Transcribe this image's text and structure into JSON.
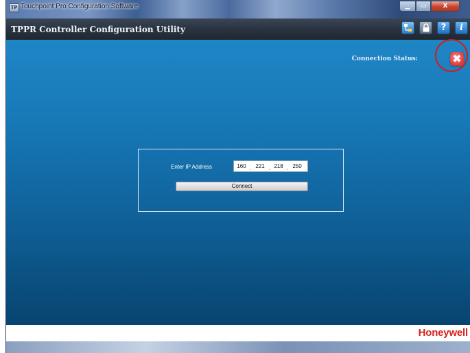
{
  "window": {
    "title": "Touchpoint Pro Configuration Software",
    "app_icon": "TP",
    "controls": {
      "minimize": "▁",
      "maximize": "▭",
      "close": "X"
    }
  },
  "header": {
    "title": "TPPR Controller Configuration Utility",
    "icons": {
      "network": "network-settings-icon",
      "lock": "lock-icon",
      "help": "?",
      "info": "i"
    }
  },
  "main": {
    "connection_status_label": "Connection Status:",
    "connection_status_icon": "✖",
    "connection_state": "disconnected",
    "ip_form": {
      "label": "Enter IP Address",
      "octets": [
        "160",
        "221",
        "218",
        "250"
      ],
      "connect_label": "Connect"
    }
  },
  "footer": {
    "brand": "Honeywell"
  },
  "colors": {
    "brand_red": "#d6211d",
    "panel_blue_top": "#1f86c6",
    "panel_blue_bottom": "#08446f",
    "highlight_ring": "#d21c1c"
  }
}
